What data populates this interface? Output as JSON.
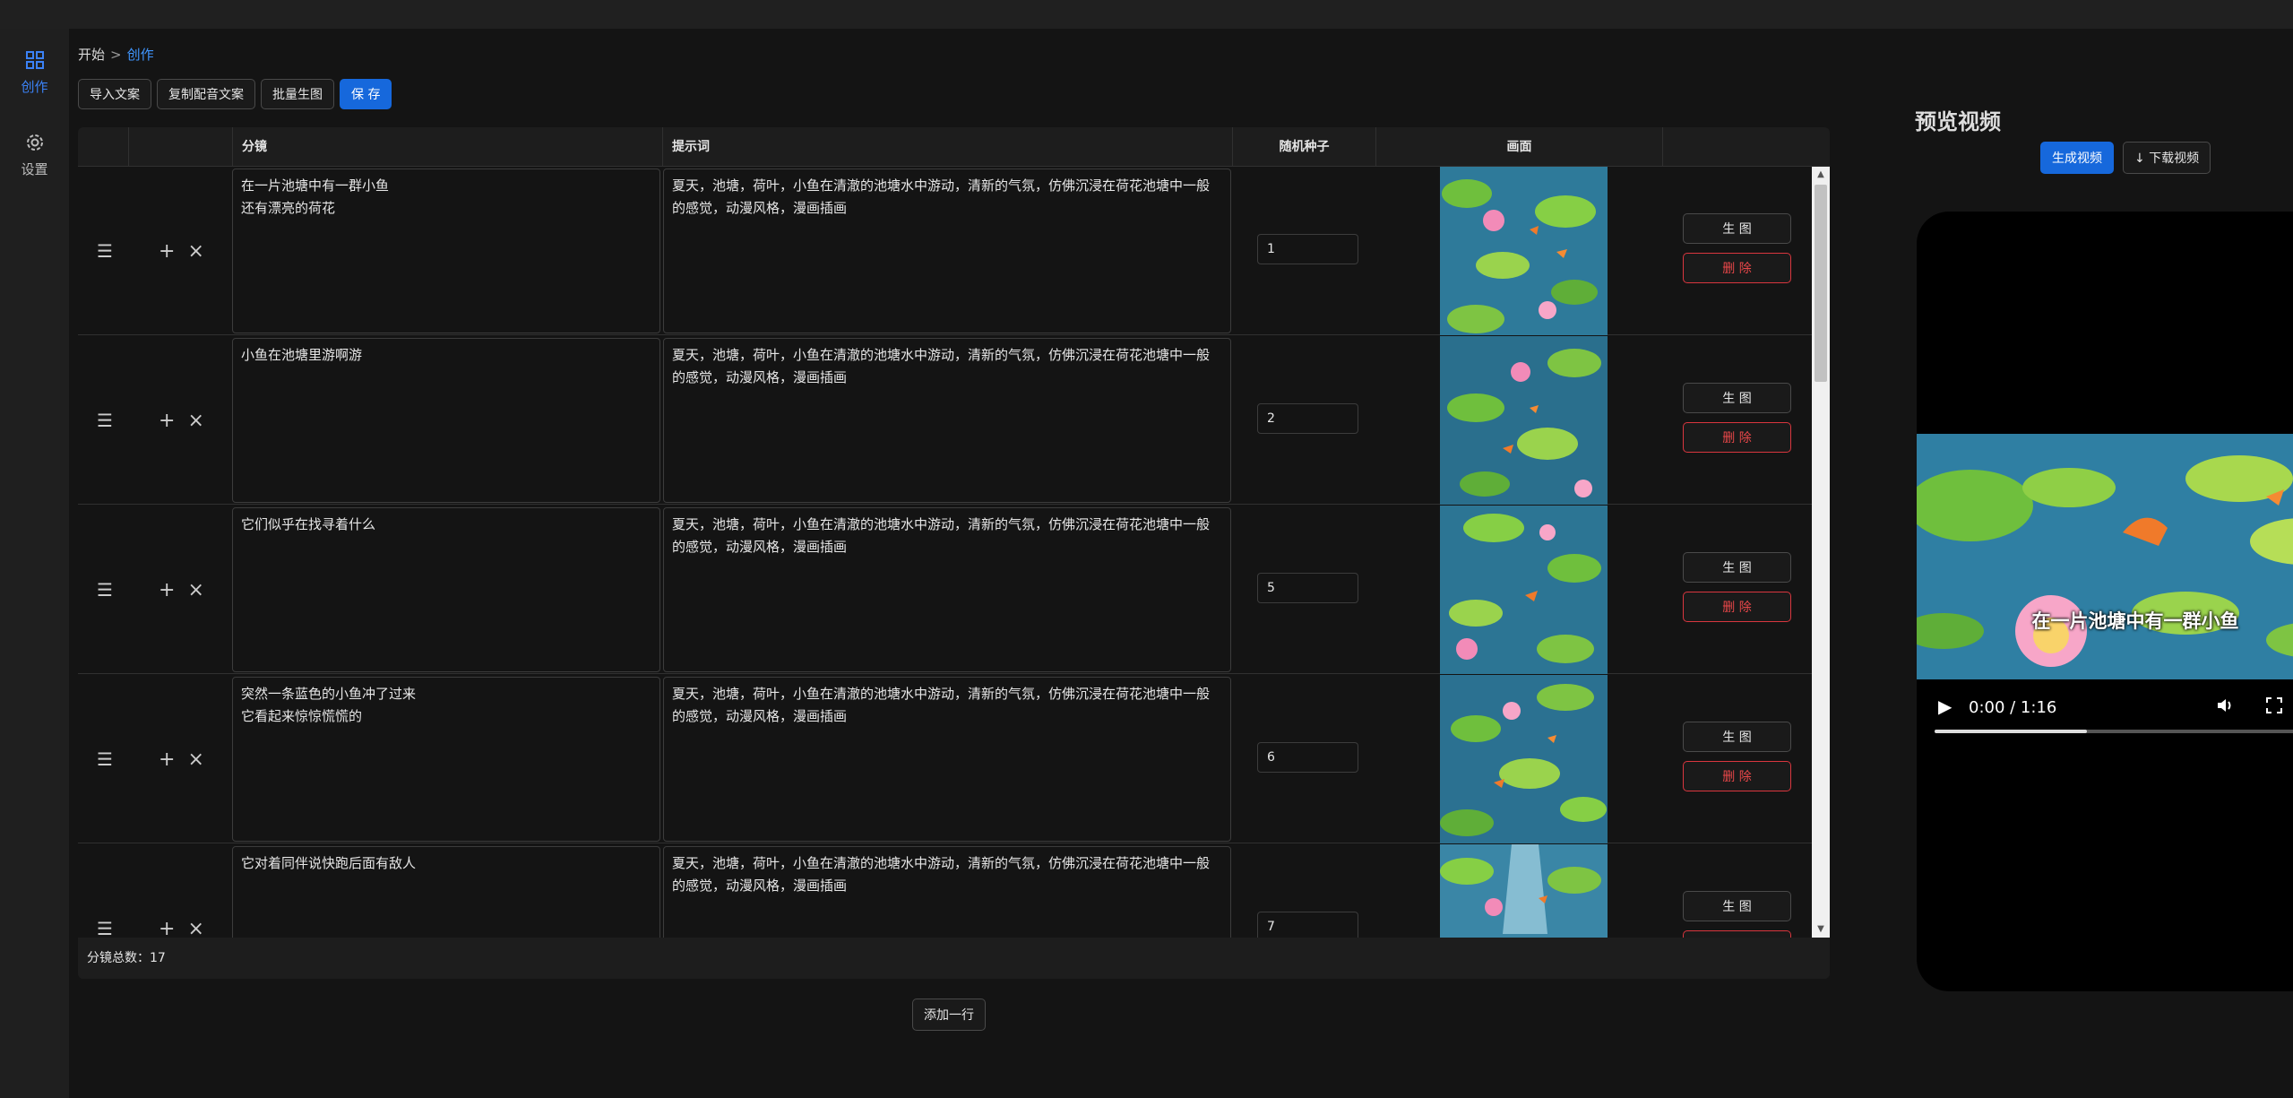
{
  "sidebar": {
    "items": [
      {
        "label": "创作",
        "icon": "grid-icon",
        "active": true
      },
      {
        "label": "设置",
        "icon": "gear-icon",
        "active": false
      }
    ]
  },
  "breadcrumb": {
    "home": "开始",
    "sep": ">",
    "current": "创作"
  },
  "toolbar": {
    "import_label": "导入文案",
    "copy_label": "复制配音文案",
    "batch_label": "批量生图",
    "save_label": "保 存"
  },
  "table": {
    "columns": [
      "",
      "",
      "分镜",
      "提示词",
      "随机种子",
      "画面",
      ""
    ],
    "rows": [
      {
        "shot": "在一片池塘中有一群小鱼\n还有漂亮的荷花",
        "prompt": "夏天，池塘，荷叶，小鱼在清澈的池塘水中游动，清新的气氛，仿佛沉浸在荷花池塘中一般的感觉，动漫风格，漫画插画",
        "seed": "1"
      },
      {
        "shot": "小鱼在池塘里游啊游",
        "prompt": "夏天，池塘，荷叶，小鱼在清澈的池塘水中游动，清新的气氛，仿佛沉浸在荷花池塘中一般的感觉，动漫风格，漫画插画",
        "seed": "2"
      },
      {
        "shot": "它们似乎在找寻着什么",
        "prompt": "夏天，池塘，荷叶，小鱼在清澈的池塘水中游动，清新的气氛，仿佛沉浸在荷花池塘中一般的感觉，动漫风格，漫画插画",
        "seed": "5"
      },
      {
        "shot": "突然一条蓝色的小鱼冲了过来\n它看起来惊惊慌慌的",
        "prompt": "夏天，池塘，荷叶，小鱼在清澈的池塘水中游动，清新的气氛，仿佛沉浸在荷花池塘中一般的感觉，动漫风格，漫画插画",
        "seed": "6"
      },
      {
        "shot": "它对着同伴说快跑后面有敌人",
        "prompt": "夏天，池塘，荷叶，小鱼在清澈的池塘水中游动，清新的气氛，仿佛沉浸在荷花池塘中一般的感觉，动漫风格，漫画插画",
        "seed": "7"
      }
    ],
    "row_gen_label": "生 图",
    "row_delete_label": "删 除",
    "footer": "分镜总数：17"
  },
  "add_row_label": "添加一行",
  "preview": {
    "title": "预览视频",
    "generate_label": "生成视频",
    "download_label": "↓ 下载视频",
    "subtitle": "在一片池塘中有一群小鱼",
    "time": "0:00 / 1:16",
    "progress": 0.38
  },
  "colors": {
    "accent": "#1668dc",
    "danger": "#e84749",
    "link": "#4096ff"
  }
}
